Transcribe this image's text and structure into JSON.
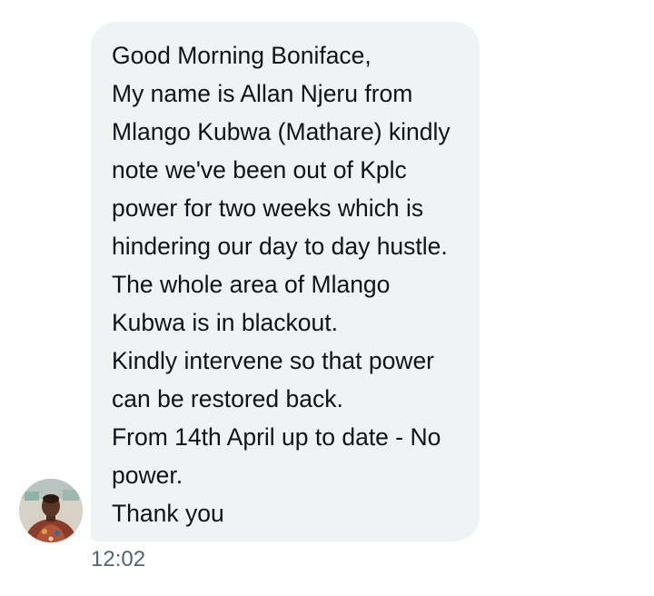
{
  "message": {
    "lines": [
      "Good Morning Boniface,",
      "My name is Allan Njeru from",
      "Mlango Kubwa (Mathare) kindly",
      "note we've been out of Kplc",
      "power for two weeks which is",
      "hindering our day to day hustle.",
      "The whole area of Mlango",
      "Kubwa is in blackout.",
      "Kindly intervene so that power",
      "can be restored back.",
      "From 14th April up to date - No",
      "power.",
      "Thank you"
    ],
    "timestamp": "12:02"
  },
  "colors": {
    "bubble": "#eff3f4",
    "text": "#0f1419",
    "timestamp": "#536471"
  },
  "avatar": {
    "icon": "user-photo-avatar"
  }
}
